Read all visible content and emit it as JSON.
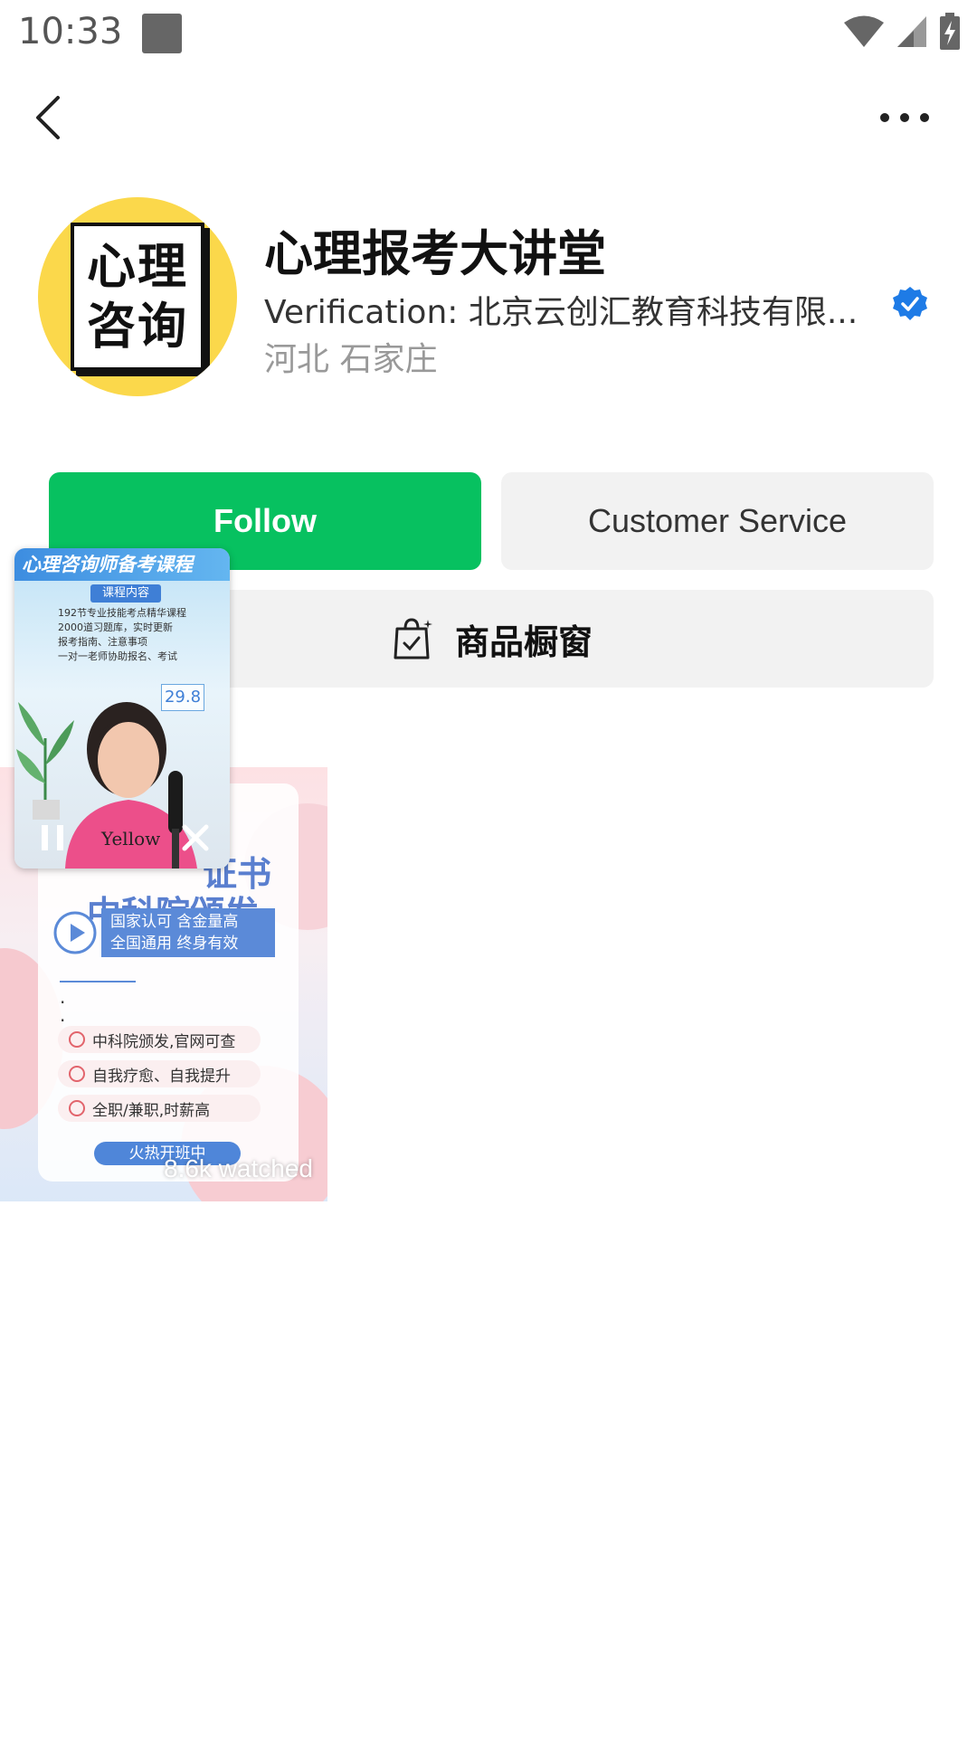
{
  "status_bar": {
    "time": "10:33"
  },
  "profile": {
    "name": "心理报考大讲堂",
    "verification": "Verification: 北京云创汇教育科技有限...",
    "location": "河北 石家庄",
    "avatar_text_line1": "心理",
    "avatar_text_line2": "咨询"
  },
  "actions": {
    "follow_label": "Follow",
    "service_label": "Customer Service",
    "shop_label": "商品橱窗"
  },
  "video": {
    "title_line1": "证书",
    "title_line2": "中科院颁发",
    "banner_line1": "国家认可 含金量高",
    "banner_line2": "全国通用 终身有效",
    "features": [
      "中科院颁发,官网可查",
      "自我疗愈、自我提升",
      "全职/兼职,时薪高"
    ],
    "pill": "火热开班中",
    "watched": "8.6k watched"
  },
  "mini_player": {
    "header": "心理咨询师备考课程",
    "sub": "课程内容",
    "lines": [
      "192节专业技能考点精华课程",
      "2000道习题库，实时更新",
      "报考指南、注意事项",
      "一对一老师协助报名、考试"
    ],
    "price": "29.8"
  },
  "colors": {
    "follow_green": "#07c160",
    "verified_blue": "#1e7be6",
    "avatar_yellow": "#fbd84b"
  },
  "icons": [
    "back-arrow-icon",
    "more-dots-icon",
    "verified-badge-icon",
    "shop-bag-icon",
    "play-icon",
    "pause-icon",
    "close-icon",
    "wifi-icon",
    "signal-icon",
    "battery-icon"
  ]
}
